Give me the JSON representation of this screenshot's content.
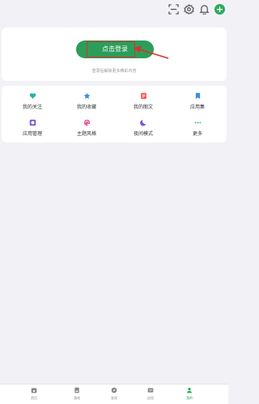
{
  "login": {
    "button_label": "点击登录",
    "hint": "登录后解锁更多精彩内容"
  },
  "grid": [
    {
      "label": "我的关注",
      "icon": "heart-plus-icon",
      "color": "#22b3a8"
    },
    {
      "label": "我的收藏",
      "icon": "star-icon",
      "color": "#3b8ee8"
    },
    {
      "label": "我的图文",
      "icon": "document-icon",
      "color": "#f0584a"
    },
    {
      "label": "应用集",
      "icon": "bookmark-icon",
      "color": "#3b8ee8"
    },
    {
      "label": "应用管理",
      "icon": "app-manage-icon",
      "color": "#7b55d9"
    },
    {
      "label": "主题风格",
      "icon": "palette-icon",
      "color": "#e85a9e"
    },
    {
      "label": "夜间模式",
      "icon": "moon-icon",
      "color": "#7b55d9"
    },
    {
      "label": "更多",
      "icon": "more-icon",
      "color": "#2dab5f"
    }
  ],
  "nav": [
    {
      "label": "首页",
      "icon": "home-icon"
    },
    {
      "label": "游戏",
      "icon": "game-icon"
    },
    {
      "label": "发现",
      "icon": "compass-icon"
    },
    {
      "label": "应用"
    },
    {
      "label": "我的",
      "icon": "user-icon"
    }
  ],
  "colors": {
    "accent": "#2dab5f",
    "highlight": "#d4332c"
  }
}
